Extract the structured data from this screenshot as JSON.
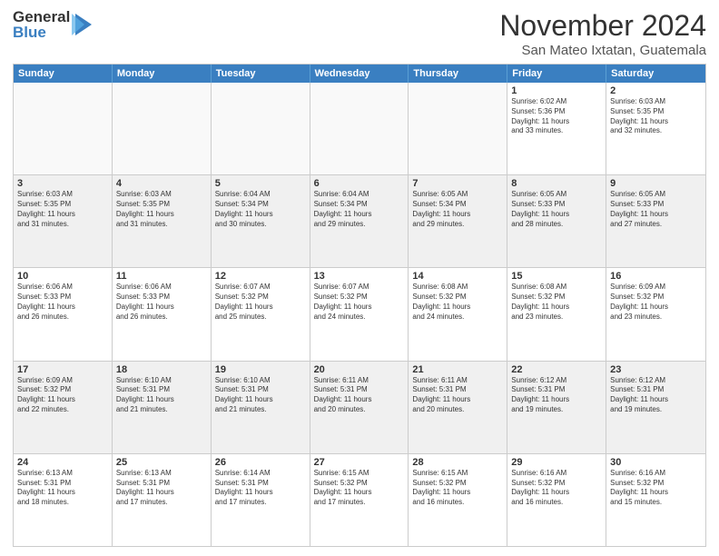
{
  "logo": {
    "general": "General",
    "blue": "Blue"
  },
  "title": {
    "month": "November 2024",
    "location": "San Mateo Ixtatan, Guatemala"
  },
  "weekdays": [
    "Sunday",
    "Monday",
    "Tuesday",
    "Wednesday",
    "Thursday",
    "Friday",
    "Saturday"
  ],
  "weeks": [
    [
      {
        "day": "",
        "info": ""
      },
      {
        "day": "",
        "info": ""
      },
      {
        "day": "",
        "info": ""
      },
      {
        "day": "",
        "info": ""
      },
      {
        "day": "",
        "info": ""
      },
      {
        "day": "1",
        "info": "Sunrise: 6:02 AM\nSunset: 5:36 PM\nDaylight: 11 hours\nand 33 minutes."
      },
      {
        "day": "2",
        "info": "Sunrise: 6:03 AM\nSunset: 5:35 PM\nDaylight: 11 hours\nand 32 minutes."
      }
    ],
    [
      {
        "day": "3",
        "info": "Sunrise: 6:03 AM\nSunset: 5:35 PM\nDaylight: 11 hours\nand 31 minutes."
      },
      {
        "day": "4",
        "info": "Sunrise: 6:03 AM\nSunset: 5:35 PM\nDaylight: 11 hours\nand 31 minutes."
      },
      {
        "day": "5",
        "info": "Sunrise: 6:04 AM\nSunset: 5:34 PM\nDaylight: 11 hours\nand 30 minutes."
      },
      {
        "day": "6",
        "info": "Sunrise: 6:04 AM\nSunset: 5:34 PM\nDaylight: 11 hours\nand 29 minutes."
      },
      {
        "day": "7",
        "info": "Sunrise: 6:05 AM\nSunset: 5:34 PM\nDaylight: 11 hours\nand 29 minutes."
      },
      {
        "day": "8",
        "info": "Sunrise: 6:05 AM\nSunset: 5:33 PM\nDaylight: 11 hours\nand 28 minutes."
      },
      {
        "day": "9",
        "info": "Sunrise: 6:05 AM\nSunset: 5:33 PM\nDaylight: 11 hours\nand 27 minutes."
      }
    ],
    [
      {
        "day": "10",
        "info": "Sunrise: 6:06 AM\nSunset: 5:33 PM\nDaylight: 11 hours\nand 26 minutes."
      },
      {
        "day": "11",
        "info": "Sunrise: 6:06 AM\nSunset: 5:33 PM\nDaylight: 11 hours\nand 26 minutes."
      },
      {
        "day": "12",
        "info": "Sunrise: 6:07 AM\nSunset: 5:32 PM\nDaylight: 11 hours\nand 25 minutes."
      },
      {
        "day": "13",
        "info": "Sunrise: 6:07 AM\nSunset: 5:32 PM\nDaylight: 11 hours\nand 24 minutes."
      },
      {
        "day": "14",
        "info": "Sunrise: 6:08 AM\nSunset: 5:32 PM\nDaylight: 11 hours\nand 24 minutes."
      },
      {
        "day": "15",
        "info": "Sunrise: 6:08 AM\nSunset: 5:32 PM\nDaylight: 11 hours\nand 23 minutes."
      },
      {
        "day": "16",
        "info": "Sunrise: 6:09 AM\nSunset: 5:32 PM\nDaylight: 11 hours\nand 23 minutes."
      }
    ],
    [
      {
        "day": "17",
        "info": "Sunrise: 6:09 AM\nSunset: 5:32 PM\nDaylight: 11 hours\nand 22 minutes."
      },
      {
        "day": "18",
        "info": "Sunrise: 6:10 AM\nSunset: 5:31 PM\nDaylight: 11 hours\nand 21 minutes."
      },
      {
        "day": "19",
        "info": "Sunrise: 6:10 AM\nSunset: 5:31 PM\nDaylight: 11 hours\nand 21 minutes."
      },
      {
        "day": "20",
        "info": "Sunrise: 6:11 AM\nSunset: 5:31 PM\nDaylight: 11 hours\nand 20 minutes."
      },
      {
        "day": "21",
        "info": "Sunrise: 6:11 AM\nSunset: 5:31 PM\nDaylight: 11 hours\nand 20 minutes."
      },
      {
        "day": "22",
        "info": "Sunrise: 6:12 AM\nSunset: 5:31 PM\nDaylight: 11 hours\nand 19 minutes."
      },
      {
        "day": "23",
        "info": "Sunrise: 6:12 AM\nSunset: 5:31 PM\nDaylight: 11 hours\nand 19 minutes."
      }
    ],
    [
      {
        "day": "24",
        "info": "Sunrise: 6:13 AM\nSunset: 5:31 PM\nDaylight: 11 hours\nand 18 minutes."
      },
      {
        "day": "25",
        "info": "Sunrise: 6:13 AM\nSunset: 5:31 PM\nDaylight: 11 hours\nand 17 minutes."
      },
      {
        "day": "26",
        "info": "Sunrise: 6:14 AM\nSunset: 5:31 PM\nDaylight: 11 hours\nand 17 minutes."
      },
      {
        "day": "27",
        "info": "Sunrise: 6:15 AM\nSunset: 5:32 PM\nDaylight: 11 hours\nand 17 minutes."
      },
      {
        "day": "28",
        "info": "Sunrise: 6:15 AM\nSunset: 5:32 PM\nDaylight: 11 hours\nand 16 minutes."
      },
      {
        "day": "29",
        "info": "Sunrise: 6:16 AM\nSunset: 5:32 PM\nDaylight: 11 hours\nand 16 minutes."
      },
      {
        "day": "30",
        "info": "Sunrise: 6:16 AM\nSunset: 5:32 PM\nDaylight: 11 hours\nand 15 minutes."
      }
    ]
  ]
}
